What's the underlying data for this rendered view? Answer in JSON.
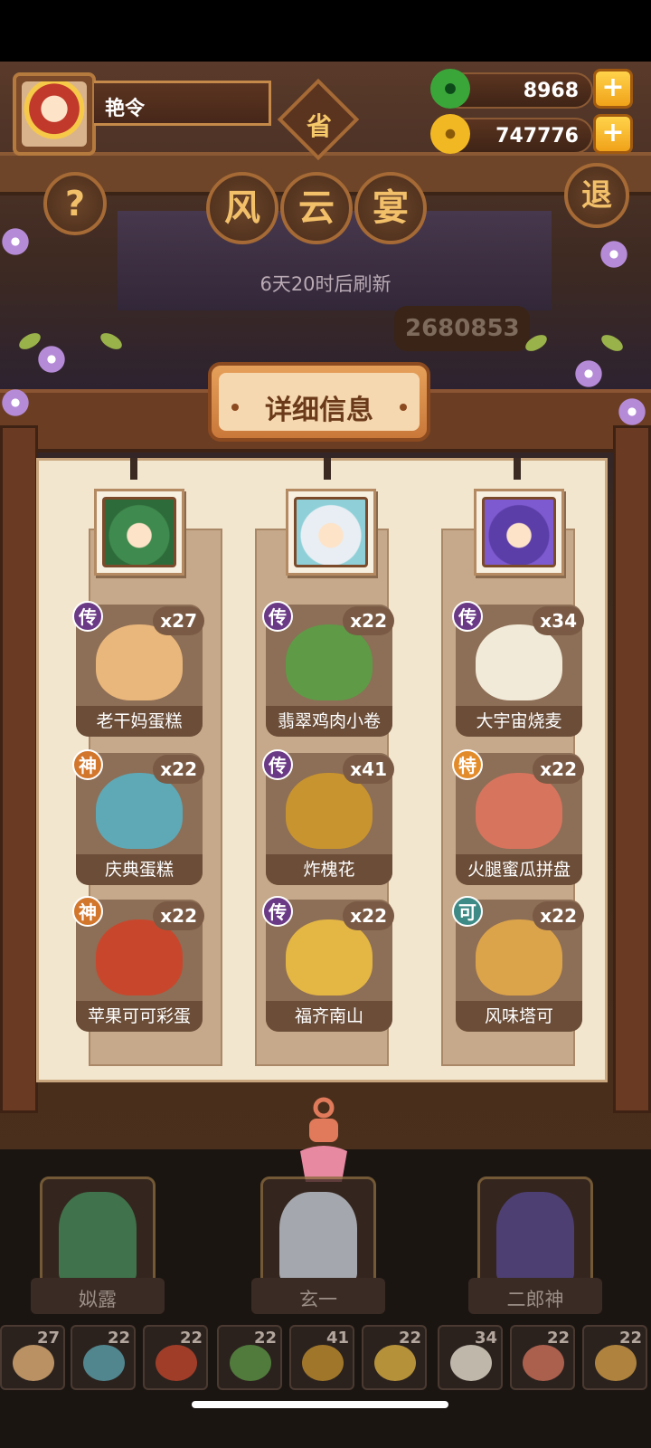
{
  "player": {
    "name": "艳令"
  },
  "resources": [
    {
      "name": "jade",
      "icon": "jade-icon",
      "value": "8968",
      "color": "#3aa63a"
    },
    {
      "name": "coin",
      "icon": "coin-icon",
      "value": "747776",
      "color": "#f2b824"
    }
  ],
  "top": {
    "province_label": "省",
    "help_label": "?",
    "exit_label": "退",
    "title_chars": [
      "风",
      "云",
      "宴"
    ],
    "refresh_text": "6天20时后刷新",
    "score": "2680853"
  },
  "panel": {
    "title": "详细信息",
    "columns": [
      {
        "chef": "chef-green-portrait",
        "dishes": [
          {
            "badge": "传",
            "count": "x27",
            "name": "老干妈蛋糕",
            "art_color": "#e9b77b"
          },
          {
            "badge": "神",
            "count": "x22",
            "name": "庆典蛋糕",
            "art_color": "#5fa8b6"
          },
          {
            "badge": "神",
            "count": "x22",
            "name": "苹果可可彩蛋",
            "art_color": "#c8472c"
          }
        ]
      },
      {
        "chef": "chef-white-portrait",
        "dishes": [
          {
            "badge": "传",
            "count": "x22",
            "name": "翡翠鸡肉小卷",
            "art_color": "#5f9a47"
          },
          {
            "badge": "传",
            "count": "x41",
            "name": "炸槐花",
            "art_color": "#c8942f"
          },
          {
            "badge": "传",
            "count": "x22",
            "name": "福齐南山",
            "art_color": "#e4b744"
          }
        ]
      },
      {
        "chef": "chef-purple-portrait",
        "dishes": [
          {
            "badge": "传",
            "count": "x34",
            "name": "大宇宙烧麦",
            "art_color": "#f1ead8"
          },
          {
            "badge": "特",
            "count": "x22",
            "name": "火腿蜜瓜拼盘",
            "art_color": "#d7745e"
          },
          {
            "badge": "可",
            "count": "x22",
            "name": "风味塔可",
            "art_color": "#dca44a"
          }
        ]
      }
    ]
  },
  "characters": [
    {
      "name": "姒露",
      "color": "#4a8a5a"
    },
    {
      "name": "玄一",
      "color": "#c7ccd4"
    },
    {
      "name": "二郎神",
      "color": "#5a4a8a"
    }
  ],
  "strip": [
    {
      "count": "27",
      "color": "#e9b77b"
    },
    {
      "count": "22",
      "color": "#5fa8b6"
    },
    {
      "count": "22",
      "color": "#c8472c"
    },
    {
      "count": "22",
      "color": "#5f9a47"
    },
    {
      "count": "41",
      "color": "#c8942f"
    },
    {
      "count": "22",
      "color": "#e4b744"
    },
    {
      "count": "34",
      "color": "#f1ead8"
    },
    {
      "count": "22",
      "color": "#d7745e"
    },
    {
      "count": "22",
      "color": "#dca44a"
    }
  ]
}
